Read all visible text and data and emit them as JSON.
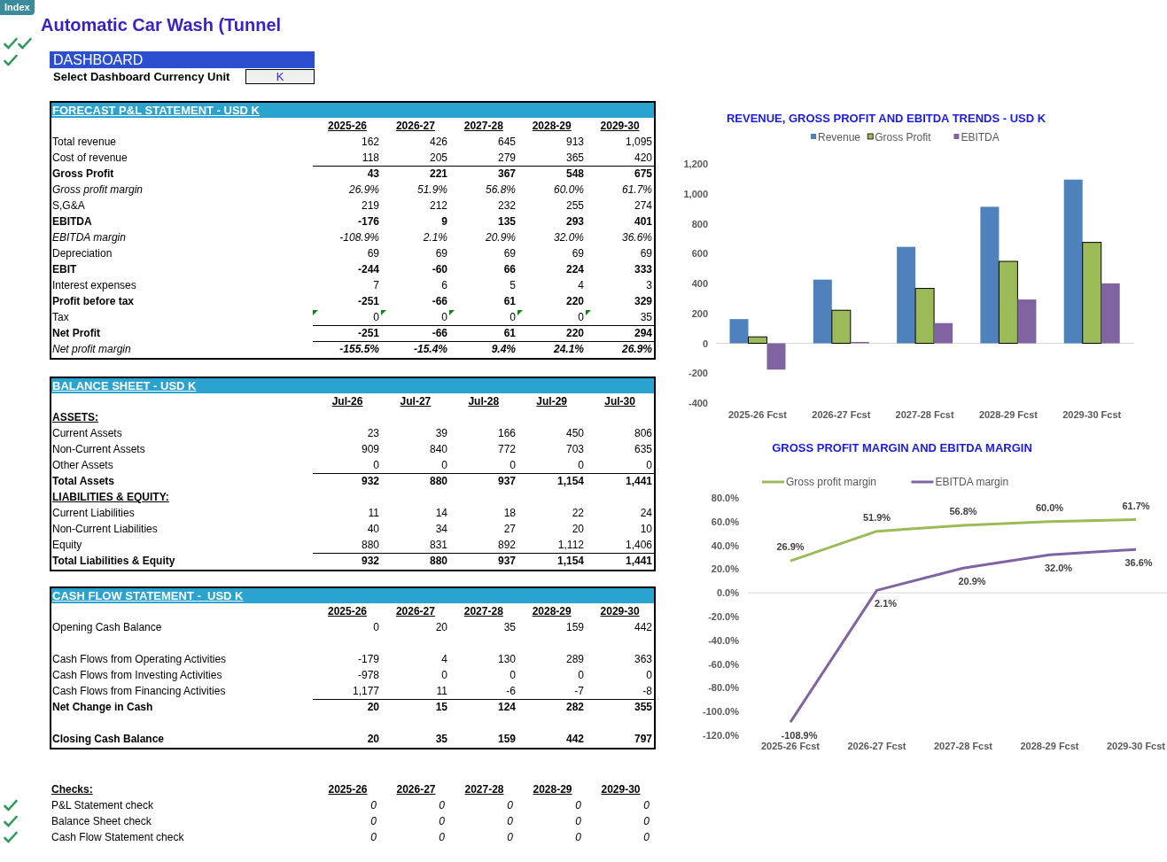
{
  "index_tab": "Index",
  "title": "Automatic Car Wash (Tunnel",
  "dashboard": {
    "heading": "DASHBOARD",
    "currency_label": "Select Dashboard Currency Unit",
    "currency_value": "K"
  },
  "pnl": {
    "title": "FORECAST P&L STATEMENT - USD K",
    "columns": [
      "2025-26",
      "2026-27",
      "2027-28",
      "2028-29",
      "2029-30"
    ],
    "rows": [
      {
        "label": "Total revenue",
        "kind": "plain",
        "rule": false,
        "flagged": false,
        "values": [
          "162",
          "426",
          "645",
          "913",
          "1,095"
        ]
      },
      {
        "label": "Cost of revenue",
        "kind": "plain",
        "rule": false,
        "flagged": false,
        "values": [
          "118",
          "205",
          "279",
          "365",
          "420"
        ]
      },
      {
        "label": "Gross Profit",
        "kind": "bold",
        "rule": true,
        "flagged": false,
        "values": [
          "43",
          "221",
          "367",
          "548",
          "675"
        ]
      },
      {
        "label": "Gross profit margin",
        "kind": "italic",
        "rule": false,
        "flagged": false,
        "values": [
          "26.9%",
          "51.9%",
          "56.8%",
          "60.0%",
          "61.7%"
        ]
      },
      {
        "label": "S,G&A",
        "kind": "plain",
        "rule": false,
        "flagged": false,
        "values": [
          "219",
          "212",
          "232",
          "255",
          "274"
        ]
      },
      {
        "label": "EBITDA",
        "kind": "bold",
        "rule": false,
        "flagged": false,
        "values": [
          "-176",
          "9",
          "135",
          "293",
          "401"
        ]
      },
      {
        "label": "EBITDA margin",
        "kind": "italic",
        "rule": false,
        "flagged": false,
        "values": [
          "-108.9%",
          "2.1%",
          "20.9%",
          "32.0%",
          "36.6%"
        ]
      },
      {
        "label": "Depreciation",
        "kind": "plain",
        "rule": false,
        "flagged": false,
        "values": [
          "69",
          "69",
          "69",
          "69",
          "69"
        ]
      },
      {
        "label": "EBIT",
        "kind": "bold",
        "rule": false,
        "flagged": false,
        "values": [
          "-244",
          "-60",
          "66",
          "224",
          "333"
        ]
      },
      {
        "label": "Interest expenses",
        "kind": "plain",
        "rule": false,
        "flagged": false,
        "values": [
          "7",
          "6",
          "5",
          "4",
          "3"
        ]
      },
      {
        "label": "Profit before tax",
        "kind": "bold",
        "rule": false,
        "flagged": false,
        "values": [
          "-251",
          "-66",
          "61",
          "220",
          "329"
        ]
      },
      {
        "label": "Tax",
        "kind": "plain",
        "rule": false,
        "flagged": true,
        "values": [
          "0",
          "0",
          "0",
          "0",
          "35"
        ]
      },
      {
        "label": "Net Profit",
        "kind": "bold",
        "rule": true,
        "flagged": false,
        "values": [
          "-251",
          "-66",
          "61",
          "220",
          "294"
        ]
      },
      {
        "label": "Net profit margin",
        "kind": "bold_italic_values",
        "rule": true,
        "flagged": false,
        "values": [
          "-155.5%",
          "-15.4%",
          "9.4%",
          "24.1%",
          "26.9%"
        ]
      }
    ]
  },
  "balance_sheet": {
    "title": "BALANCE SHEET - USD K",
    "columns": [
      "Jul-26",
      "Jul-27",
      "Jul-28",
      "Jul-29",
      "Jul-30"
    ],
    "rows": [
      {
        "label": "ASSETS:",
        "kind": "heading",
        "values": []
      },
      {
        "label": "Current Assets",
        "kind": "plain",
        "rule": false,
        "values": [
          "23",
          "39",
          "166",
          "450",
          "806"
        ]
      },
      {
        "label": "Non-Current Assets",
        "kind": "plain",
        "rule": false,
        "values": [
          "909",
          "840",
          "772",
          "703",
          "635"
        ]
      },
      {
        "label": "Other Assets",
        "kind": "plain",
        "rule": false,
        "values": [
          "0",
          "0",
          "0",
          "0",
          "0"
        ]
      },
      {
        "label": "Total Assets",
        "kind": "bold",
        "rule": true,
        "values": [
          "932",
          "880",
          "937",
          "1,154",
          "1,441"
        ]
      },
      {
        "label": "LIABILITIES & EQUITY:",
        "kind": "heading",
        "values": []
      },
      {
        "label": "Current Liabilities",
        "kind": "plain",
        "rule": false,
        "values": [
          "11",
          "14",
          "18",
          "22",
          "24"
        ]
      },
      {
        "label": "Non-Current Liabilities",
        "kind": "plain",
        "rule": false,
        "values": [
          "40",
          "34",
          "27",
          "20",
          "10"
        ]
      },
      {
        "label": "Equity",
        "kind": "plain",
        "rule": false,
        "values": [
          "880",
          "831",
          "892",
          "1,112",
          "1,406"
        ]
      },
      {
        "label": "Total Liabilities & Equity",
        "kind": "bold",
        "rule": true,
        "values": [
          "932",
          "880",
          "937",
          "1,154",
          "1,441"
        ]
      }
    ]
  },
  "cash_flow": {
    "title": "CASH FLOW STATEMENT -  USD K",
    "columns": [
      "2025-26",
      "2026-27",
      "2027-28",
      "2028-29",
      "2029-30"
    ],
    "rows": [
      {
        "label": "Opening Cash Balance",
        "kind": "plain",
        "rule": false,
        "gap_before": false,
        "values": [
          "0",
          "20",
          "35",
          "159",
          "442"
        ]
      },
      {
        "label": "Cash Flows from Operating Activities",
        "kind": "plain",
        "rule": false,
        "gap_before": true,
        "values": [
          "-179",
          "4",
          "130",
          "289",
          "363"
        ]
      },
      {
        "label": "Cash Flows from Investing Activities",
        "kind": "plain",
        "rule": false,
        "gap_before": false,
        "values": [
          "-978",
          "0",
          "0",
          "0",
          "0"
        ]
      },
      {
        "label": "Cash Flows from Financing Activities",
        "kind": "plain",
        "rule": false,
        "gap_before": false,
        "values": [
          "1,177",
          "11",
          "-6",
          "-7",
          "-8"
        ]
      },
      {
        "label": "Net Change in Cash",
        "kind": "bold",
        "rule": true,
        "gap_before": false,
        "values": [
          "20",
          "15",
          "124",
          "282",
          "355"
        ]
      },
      {
        "label": "Closing Cash Balance",
        "kind": "bold",
        "rule": false,
        "gap_before": true,
        "values": [
          "20",
          "35",
          "159",
          "442",
          "797"
        ]
      }
    ]
  },
  "checks": {
    "title": "Checks:",
    "columns": [
      "2025-26",
      "2026-27",
      "2027-28",
      "2028-29",
      "2029-30"
    ],
    "rows": [
      {
        "label": "P&L Statement check",
        "passed": true,
        "values": [
          "0",
          "0",
          "0",
          "0",
          "0"
        ]
      },
      {
        "label": "Balance Sheet check",
        "passed": true,
        "values": [
          "0",
          "0",
          "0",
          "0",
          "0"
        ]
      },
      {
        "label": "Cash Flow Statement check",
        "passed": true,
        "values": [
          "0",
          "0",
          "0",
          "0",
          "0"
        ]
      }
    ]
  },
  "charts": [
    {
      "chart_data": {
        "type": "bar",
        "title": "REVENUE, GROSS PROFIT AND EBITDA TRENDS - USD K",
        "categories": [
          "2025-26 Fcst",
          "2026-27 Fcst",
          "2027-28 Fcst",
          "2028-29 Fcst",
          "2029-30 Fcst"
        ],
        "series": [
          {
            "name": "Revenue",
            "color": "#4f81bd",
            "values": [
              162,
              426,
              645,
              913,
              1095
            ]
          },
          {
            "name": "Gross Profit",
            "color": "#9bbb59",
            "values": [
              43,
              221,
              367,
              548,
              675
            ]
          },
          {
            "name": "EBITDA",
            "color": "#8064a2",
            "values": [
              -176,
              9,
              135,
              293,
              401
            ]
          }
        ],
        "legend": "top",
        "ylim": [
          -400,
          1200
        ],
        "yticks": [
          {
            "value": -400,
            "label": "-400"
          },
          {
            "value": -200,
            "label": "-200"
          },
          {
            "value": 0,
            "label": "0"
          },
          {
            "value": 200,
            "label": "200"
          },
          {
            "value": 400,
            "label": "400"
          },
          {
            "value": 600,
            "label": "600"
          },
          {
            "value": 800,
            "label": "800"
          },
          {
            "value": 1000,
            "label": "1,000"
          },
          {
            "value": 1200,
            "label": "1,200"
          }
        ]
      }
    },
    {
      "chart_data": {
        "type": "line",
        "title": "GROSS PROFIT MARGIN AND EBITDA MARGIN",
        "categories": [
          "2025-26 Fcst",
          "2026-27 Fcst",
          "2027-28 Fcst",
          "2028-29 Fcst",
          "2029-30 Fcst"
        ],
        "series": [
          {
            "name": "Gross profit margin",
            "color": "#9bbb59",
            "values": [
              26.9,
              51.9,
              56.8,
              60.0,
              61.7
            ]
          },
          {
            "name": "EBITDA margin",
            "color": "#8064a2",
            "values": [
              -108.9,
              2.1,
              20.9,
              32.0,
              36.6
            ]
          }
        ],
        "legend": "top",
        "ylim": [
          -120,
          80
        ],
        "yticks": [
          {
            "value": 80,
            "label": "80.0%"
          },
          {
            "value": 60,
            "label": "60.0%"
          },
          {
            "value": 40,
            "label": "40.0%"
          },
          {
            "value": 20,
            "label": "20.0%"
          },
          {
            "value": 0,
            "label": "0.0%"
          },
          {
            "value": -20,
            "label": "-20.0%"
          },
          {
            "value": -40,
            "label": "-40.0%"
          },
          {
            "value": -60,
            "label": "-60.0%"
          },
          {
            "value": -80,
            "label": "-80.0%"
          },
          {
            "value": -100,
            "label": "-100.0%"
          },
          {
            "value": -120,
            "label": "-120.0%"
          }
        ],
        "value_labels": [
          [
            "26.9%",
            "51.9%",
            "56.8%",
            "60.0%",
            "61.7%"
          ],
          [
            "-108.9%",
            "2.1%",
            "20.9%",
            "32.0%",
            "36.6%"
          ]
        ]
      }
    }
  ]
}
